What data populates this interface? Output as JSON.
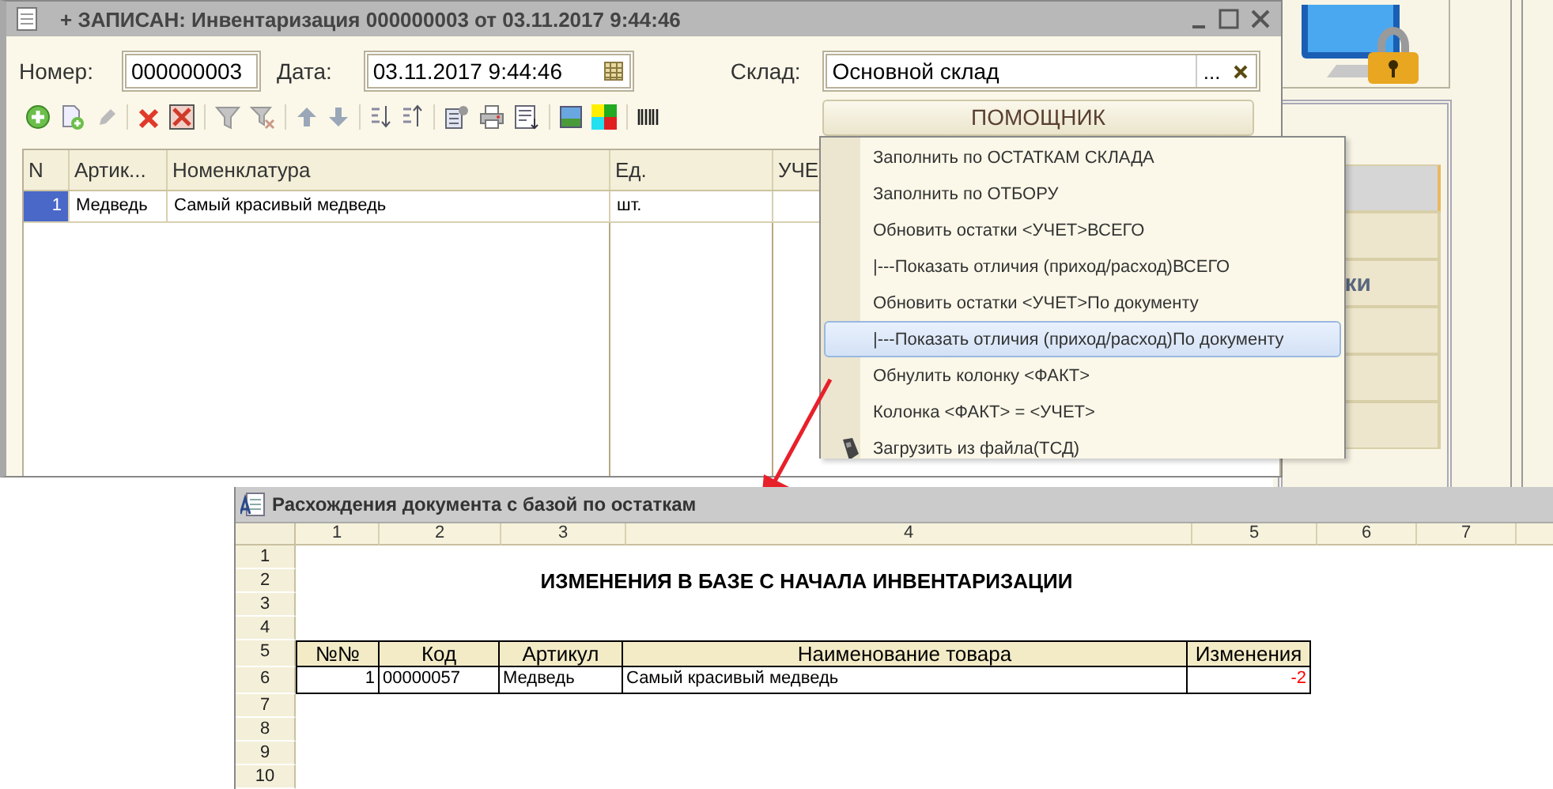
{
  "main_window": {
    "title": "+ ЗАПИСАН: Инвентаризация 000000003 от 03.11.2017 9:44:46",
    "number": {
      "label": "Номер:",
      "value": "000000003"
    },
    "date": {
      "label": "Дата:",
      "value": "03.11.2017 9:44:46"
    },
    "warehouse": {
      "label": "Склад:",
      "value": "Основной склад",
      "select_button": "..."
    },
    "helper_button": "ПОМОЩНИК",
    "table": {
      "columns": [
        "N",
        "Артик...",
        "Номенклатура",
        "Ед.",
        "УЧЕ"
      ],
      "rows": [
        {
          "n": "1",
          "article": "Медведь",
          "name": "Самый красивый медведь",
          "unit": "шт.",
          "selected": true
        }
      ]
    }
  },
  "helper_menu": {
    "items": [
      {
        "label": "Заполнить по ОСТАТКАМ СКЛАДА",
        "selected": false,
        "kind": "plain"
      },
      {
        "label": "Заполнить по ОТБОРУ",
        "selected": false,
        "kind": "plain"
      },
      {
        "label": "Обновить остатки <УЧЕТ>ВСЕГО",
        "selected": false,
        "kind": "plain"
      },
      {
        "label": "|---Показать отличия (приход/расход)ВСЕГО",
        "selected": false,
        "kind": "plain"
      },
      {
        "label": "Обновить остатки <УЧЕТ>По документу",
        "selected": false,
        "kind": "plain"
      },
      {
        "label": "|---Показать отличия (приход/расход)По документу",
        "selected": true,
        "kind": "plain"
      },
      {
        "label": "Обнулить колонку <ФАКТ>",
        "selected": false,
        "kind": "plain"
      },
      {
        "label": "Колонка <ФАКТ> = <УЧЕТ>",
        "selected": false,
        "kind": "plain"
      },
      {
        "label": "Загрузить из файла(ТСД)",
        "selected": false,
        "kind": "device"
      }
    ]
  },
  "side_panel": {
    "buttons": [
      {
        "selected": true
      },
      {
        "selected": false
      },
      {
        "label": "ки",
        "selected": false
      },
      {
        "selected": false
      },
      {
        "selected": false
      },
      {
        "selected": false
      }
    ]
  },
  "report_window": {
    "title": "Расхождения документа с базой по остаткам",
    "column_headers": [
      "1",
      "2",
      "3",
      "4",
      "5",
      "6",
      "7"
    ],
    "row_headers": [
      "1",
      "2",
      "3",
      "4",
      "5",
      "6",
      "7",
      "8",
      "9",
      "10"
    ],
    "heading": "ИЗМЕНЕНИЯ В БАЗЕ С НАЧАЛА ИНВЕНТАРИЗАЦИИ",
    "table": {
      "columns": [
        "№№",
        "Код",
        "Артикул",
        "Наименование товара",
        "Изменения"
      ],
      "rows": [
        {
          "cells": [
            "1",
            "00000057",
            "Медведь",
            "Самый красивый медведь",
            "-2"
          ],
          "negative": true
        }
      ]
    }
  }
}
